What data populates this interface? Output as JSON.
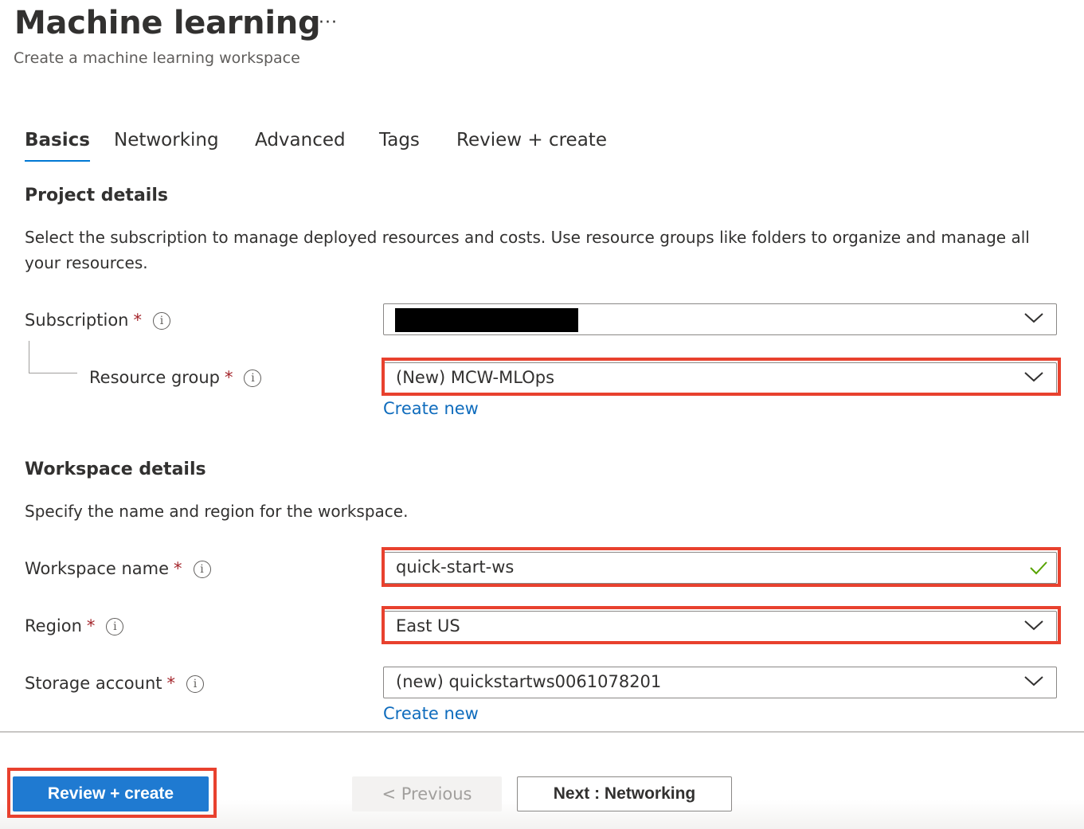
{
  "header": {
    "title": "Machine learning",
    "more_label": "···",
    "subtitle": "Create a machine learning workspace"
  },
  "tabs": [
    {
      "label": "Basics",
      "active": true
    },
    {
      "label": "Networking",
      "active": false
    },
    {
      "label": "Advanced",
      "active": false
    },
    {
      "label": "Tags",
      "active": false
    },
    {
      "label": "Review + create",
      "active": false
    }
  ],
  "project": {
    "title": "Project details",
    "description": "Select the subscription to manage deployed resources and costs. Use resource groups like folders to organize and manage all your resources.",
    "subscription": {
      "label": "Subscription",
      "value": ""
    },
    "resource_group": {
      "label": "Resource group",
      "value": "(New) MCW-MLOps",
      "create_new": "Create new"
    }
  },
  "workspace": {
    "title": "Workspace details",
    "description": "Specify the name and region for the workspace.",
    "name": {
      "label": "Workspace name",
      "value": "quick-start-ws"
    },
    "region": {
      "label": "Region",
      "value": "East US"
    },
    "storage": {
      "label": "Storage account",
      "value": "(new) quickstartws0061078201",
      "create_new": "Create new"
    }
  },
  "common": {
    "required_mark": "*",
    "info_glyph": "i"
  },
  "footer": {
    "review_create": "Review + create",
    "previous": "< Previous",
    "next": "Next : Networking"
  },
  "colors": {
    "accent": "#0078d4",
    "primary_button": "#1f7ad1",
    "highlight_border": "#e8412e",
    "link": "#0f6cbd",
    "required": "#a4262c",
    "valid_check": "#57a300"
  }
}
